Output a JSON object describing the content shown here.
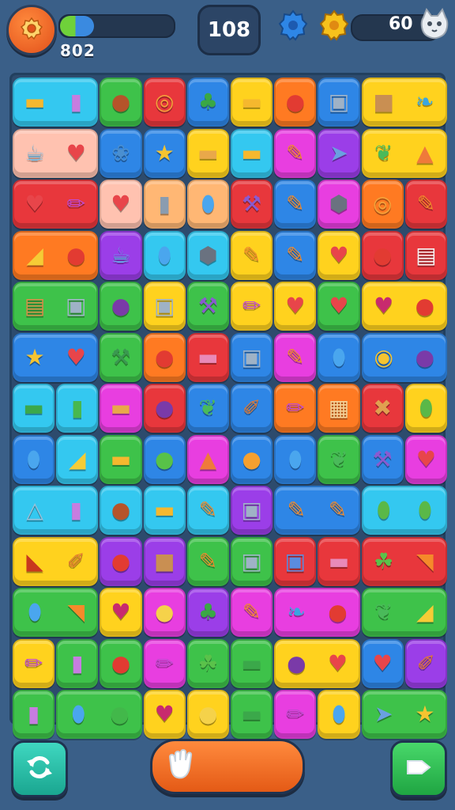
{
  "hud": {
    "moves": "108",
    "progress_value": "802",
    "progress_fraction": 0.3,
    "coins": "60"
  },
  "icons": {
    "settings": "gear-icon",
    "blue_badge": "blue-gear-badge-icon",
    "gold_badge": "gold-gear-badge-icon",
    "coin": "cat-coin-icon",
    "undo": "undo-arrows-icon",
    "hint": "hand-icon",
    "next": "play-arrow-icon"
  },
  "colors": {
    "background": "#3a5f88",
    "red": "#e8373c",
    "orange": "#ff7a22",
    "yellow": "#ffd21e",
    "green": "#3ec24a",
    "cyan": "#34c8f0",
    "blue": "#2e86e6",
    "purple": "#9b3ee8",
    "magenta": "#e83ee0",
    "pink": "#ffc2b0",
    "lightorange": "#ffb774"
  },
  "board": {
    "rows": [
      [
        {
          "c": "cyan",
          "span": 2,
          "items": [
            "corn",
            "bottle"
          ]
        },
        {
          "c": "green",
          "span": 1,
          "items": [
            "drumstick"
          ]
        },
        {
          "c": "red",
          "span": 1,
          "items": [
            "donut"
          ]
        },
        {
          "c": "blue",
          "span": 1,
          "items": [
            "broccoli"
          ]
        },
        {
          "c": "yellow",
          "span": 1,
          "items": [
            "corn"
          ]
        },
        {
          "c": "orange",
          "span": 1,
          "items": [
            "apple"
          ]
        },
        {
          "c": "blue",
          "span": 1,
          "items": [
            "jar"
          ]
        },
        {
          "c": "yellow",
          "span": 2,
          "items": [
            "box",
            "feather"
          ]
        }
      ],
      [
        {
          "c": "pink",
          "span": 2,
          "items": [
            "teapot",
            "heart"
          ]
        },
        {
          "c": "blue",
          "span": 1,
          "items": [
            "fan"
          ]
        },
        {
          "c": "blue",
          "span": 1,
          "items": [
            "star"
          ]
        },
        {
          "c": "yellow",
          "span": 1,
          "items": [
            "bread"
          ]
        },
        {
          "c": "cyan",
          "span": 1,
          "items": [
            "corn"
          ]
        },
        {
          "c": "magenta",
          "span": 1,
          "items": [
            "pencil"
          ]
        },
        {
          "c": "purple",
          "span": 1,
          "items": [
            "fish"
          ]
        },
        {
          "c": "yellow",
          "span": 2,
          "items": [
            "leaf",
            "popsicle"
          ]
        }
      ],
      [
        {
          "c": "red",
          "span": 2,
          "items": [
            "heart",
            "crayon"
          ]
        },
        {
          "c": "pink",
          "span": 1,
          "items": [
            "heart"
          ]
        },
        {
          "c": "lightorange",
          "span": 1,
          "items": [
            "can"
          ]
        },
        {
          "c": "lightorange",
          "span": 1,
          "items": [
            "balloon"
          ]
        },
        {
          "c": "red",
          "span": 1,
          "items": [
            "spoon"
          ]
        },
        {
          "c": "blue",
          "span": 1,
          "items": [
            "pencil"
          ]
        },
        {
          "c": "magenta",
          "span": 1,
          "items": [
            "rock"
          ]
        },
        {
          "c": "orange",
          "span": 1,
          "items": [
            "donut"
          ]
        },
        {
          "c": "red",
          "span": 1,
          "items": [
            "pencil"
          ]
        }
      ],
      [
        {
          "c": "orange",
          "span": 2,
          "items": [
            "cheese",
            "apple"
          ]
        },
        {
          "c": "purple",
          "span": 1,
          "items": [
            "teapot"
          ]
        },
        {
          "c": "cyan",
          "span": 1,
          "items": [
            "balloon"
          ]
        },
        {
          "c": "cyan",
          "span": 1,
          "items": [
            "rock"
          ]
        },
        {
          "c": "yellow",
          "span": 1,
          "items": [
            "pencil"
          ]
        },
        {
          "c": "blue",
          "span": 1,
          "items": [
            "pencil"
          ]
        },
        {
          "c": "yellow",
          "span": 1,
          "items": [
            "heart"
          ]
        },
        {
          "c": "red",
          "span": 1,
          "items": [
            "apple"
          ]
        },
        {
          "c": "red",
          "span": 1,
          "items": [
            "boot"
          ]
        }
      ],
      [
        {
          "c": "green",
          "span": 2,
          "items": [
            "cake",
            "jar"
          ]
        },
        {
          "c": "green",
          "span": 1,
          "items": [
            "plum"
          ]
        },
        {
          "c": "yellow",
          "span": 1,
          "items": [
            "jar"
          ]
        },
        {
          "c": "green",
          "span": 1,
          "items": [
            "spoon"
          ]
        },
        {
          "c": "yellow",
          "span": 1,
          "items": [
            "crayon"
          ]
        },
        {
          "c": "yellow",
          "span": 1,
          "items": [
            "heart"
          ]
        },
        {
          "c": "green",
          "span": 1,
          "items": [
            "heart"
          ]
        },
        {
          "c": "yellow",
          "span": 2,
          "items": [
            "beet",
            "apple"
          ]
        }
      ],
      [
        {
          "c": "blue",
          "span": 2,
          "items": [
            "star",
            "heart"
          ]
        },
        {
          "c": "green",
          "span": 1,
          "items": [
            "spatula"
          ]
        },
        {
          "c": "orange",
          "span": 1,
          "items": [
            "apple"
          ]
        },
        {
          "c": "red",
          "span": 1,
          "items": [
            "eraser"
          ]
        },
        {
          "c": "blue",
          "span": 1,
          "items": [
            "jar"
          ]
        },
        {
          "c": "magenta",
          "span": 1,
          "items": [
            "pencil"
          ]
        },
        {
          "c": "blue",
          "span": 1,
          "items": [
            "balloon"
          ]
        },
        {
          "c": "blue",
          "span": 2,
          "items": [
            "clock",
            "plum"
          ]
        }
      ],
      [
        {
          "c": "cyan",
          "span": 1,
          "items": [
            "cucumber"
          ]
        },
        {
          "c": "cyan",
          "span": 1,
          "items": [
            "cup"
          ]
        },
        {
          "c": "magenta",
          "span": 1,
          "items": [
            "bread"
          ]
        },
        {
          "c": "red",
          "span": 1,
          "items": [
            "plum"
          ]
        },
        {
          "c": "blue",
          "span": 1,
          "items": [
            "leaf"
          ]
        },
        {
          "c": "blue",
          "span": 1,
          "items": [
            "brush"
          ]
        },
        {
          "c": "orange",
          "span": 1,
          "items": [
            "crayon"
          ]
        },
        {
          "c": "orange",
          "span": 1,
          "items": [
            "ruler"
          ]
        },
        {
          "c": "red",
          "span": 1,
          "items": [
            "cross"
          ]
        },
        {
          "c": "yellow",
          "span": 1,
          "items": [
            "melon"
          ]
        }
      ],
      [
        {
          "c": "blue",
          "span": 1,
          "items": [
            "balloon"
          ]
        },
        {
          "c": "cyan",
          "span": 1,
          "items": [
            "cheese"
          ]
        },
        {
          "c": "green",
          "span": 1,
          "items": [
            "corn"
          ]
        },
        {
          "c": "blue",
          "span": 1,
          "items": [
            "pepper"
          ]
        },
        {
          "c": "magenta",
          "span": 1,
          "items": [
            "popsicle"
          ]
        },
        {
          "c": "blue",
          "span": 1,
          "items": [
            "orange"
          ]
        },
        {
          "c": "blue",
          "span": 1,
          "items": [
            "balloon"
          ]
        },
        {
          "c": "green",
          "span": 1,
          "items": [
            "leaf"
          ]
        },
        {
          "c": "blue",
          "span": 1,
          "items": [
            "spoon"
          ]
        },
        {
          "c": "magenta",
          "span": 1,
          "items": [
            "heart"
          ]
        }
      ],
      [
        {
          "c": "cyan",
          "span": 2,
          "items": [
            "bag",
            "bottle"
          ]
        },
        {
          "c": "cyan",
          "span": 1,
          "items": [
            "drumstick"
          ]
        },
        {
          "c": "cyan",
          "span": 1,
          "items": [
            "corn"
          ]
        },
        {
          "c": "cyan",
          "span": 1,
          "items": [
            "pencil"
          ]
        },
        {
          "c": "purple",
          "span": 1,
          "items": [
            "jar"
          ]
        },
        {
          "c": "blue",
          "span": 2,
          "items": [
            "pencil",
            "pencil"
          ]
        },
        {
          "c": "cyan",
          "span": 2,
          "items": [
            "melon",
            "melon"
          ]
        }
      ],
      [
        {
          "c": "yellow",
          "span": 2,
          "items": [
            "chili",
            "brush"
          ]
        },
        {
          "c": "purple",
          "span": 1,
          "items": [
            "apple"
          ]
        },
        {
          "c": "purple",
          "span": 1,
          "items": [
            "box"
          ]
        },
        {
          "c": "green",
          "span": 1,
          "items": [
            "pencil"
          ]
        },
        {
          "c": "green",
          "span": 1,
          "items": [
            "jar"
          ]
        },
        {
          "c": "red",
          "span": 1,
          "items": [
            "carton"
          ]
        },
        {
          "c": "red",
          "span": 1,
          "items": [
            "eraser"
          ]
        },
        {
          "c": "red",
          "span": 2,
          "items": [
            "tomato",
            "carrot"
          ]
        }
      ],
      [
        {
          "c": "green",
          "span": 2,
          "items": [
            "balloon",
            "carrot"
          ]
        },
        {
          "c": "yellow",
          "span": 1,
          "items": [
            "beet"
          ]
        },
        {
          "c": "magenta",
          "span": 1,
          "items": [
            "onion"
          ]
        },
        {
          "c": "purple",
          "span": 1,
          "items": [
            "broccoli"
          ]
        },
        {
          "c": "magenta",
          "span": 1,
          "items": [
            "pencil"
          ]
        },
        {
          "c": "magenta",
          "span": 2,
          "items": [
            "feather",
            "apple"
          ]
        },
        {
          "c": "green",
          "span": 2,
          "items": [
            "leaf",
            "cheese"
          ]
        }
      ],
      [
        {
          "c": "yellow",
          "span": 1,
          "items": [
            "crayon"
          ]
        },
        {
          "c": "green",
          "span": 1,
          "items": [
            "bottle"
          ]
        },
        {
          "c": "green",
          "span": 1,
          "items": [
            "apple"
          ]
        },
        {
          "c": "magenta",
          "span": 1,
          "items": [
            "crayon"
          ]
        },
        {
          "c": "green",
          "span": 1,
          "items": [
            "tomato"
          ]
        },
        {
          "c": "green",
          "span": 1,
          "items": [
            "cucumber"
          ]
        },
        {
          "c": "yellow",
          "span": 2,
          "items": [
            "plum",
            "heart"
          ]
        },
        {
          "c": "blue",
          "span": 1,
          "items": [
            "heart"
          ]
        },
        {
          "c": "purple",
          "span": 1,
          "items": [
            "brush"
          ]
        }
      ],
      [
        {
          "c": "green",
          "span": 1,
          "items": [
            "bottle"
          ]
        },
        {
          "c": "green",
          "span": 2,
          "items": [
            "balloon",
            "frog"
          ]
        },
        {
          "c": "yellow",
          "span": 1,
          "items": [
            "beet"
          ]
        },
        {
          "c": "yellow",
          "span": 1,
          "items": [
            "onion"
          ]
        },
        {
          "c": "green",
          "span": 1,
          "items": [
            "cucumber"
          ]
        },
        {
          "c": "magenta",
          "span": 1,
          "items": [
            "crayon"
          ]
        },
        {
          "c": "yellow",
          "span": 1,
          "items": [
            "balloon"
          ]
        },
        {
          "c": "green",
          "span": 2,
          "items": [
            "fish",
            "star"
          ]
        }
      ]
    ]
  }
}
